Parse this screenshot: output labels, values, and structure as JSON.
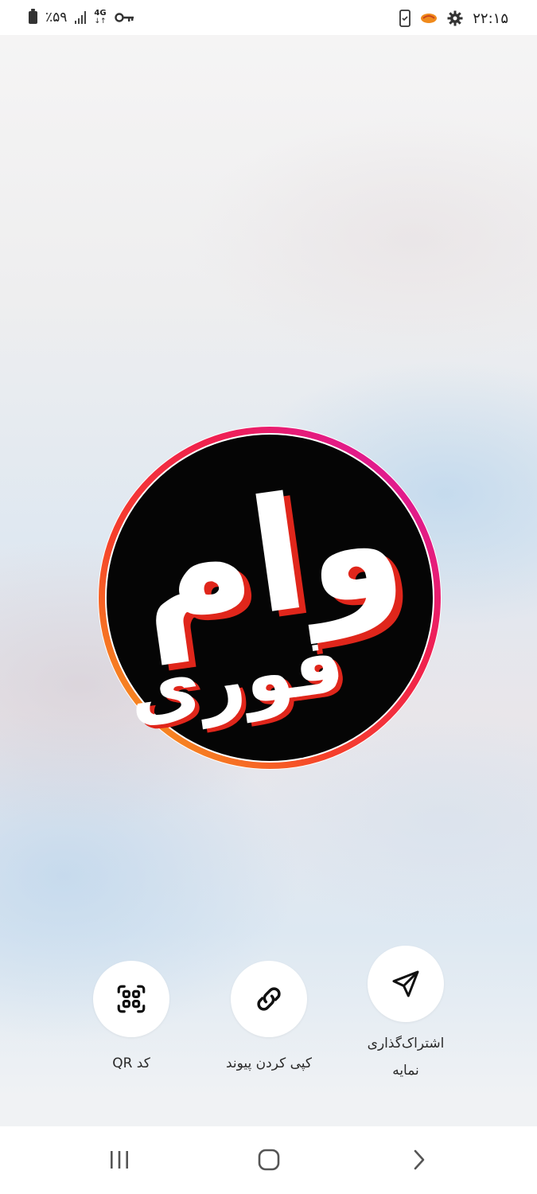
{
  "status_bar": {
    "time": "۲۲:۱۵",
    "battery": "٪۵۹",
    "network": "4G",
    "icons": [
      "phone-check-icon",
      "app-notification-icon",
      "settings-gear-icon",
      "vpn-key-icon",
      "signal-bars-icon",
      "battery-icon"
    ]
  },
  "logo": {
    "text_top": "وام",
    "text_bottom": "فوری",
    "colors": {
      "ring_start": "#e4179b",
      "ring_mid": "#f5402a",
      "ring_end": "#f7a21b",
      "disc": "#050505",
      "letter": "#ffffff",
      "letter_shadow": "#e0261b"
    }
  },
  "actions": {
    "share": {
      "label_line1": "اشتراک‌گذاری",
      "label_line2": "نمایه",
      "icon": "send-icon"
    },
    "copy_link": {
      "label": "کپی کردن پیوند",
      "icon": "link-icon"
    },
    "qr_code": {
      "label": "کد QR",
      "icon": "qr-scan-icon"
    }
  },
  "nav_bar": {
    "items": [
      "recent-apps-icon",
      "home-icon",
      "back-icon"
    ]
  }
}
